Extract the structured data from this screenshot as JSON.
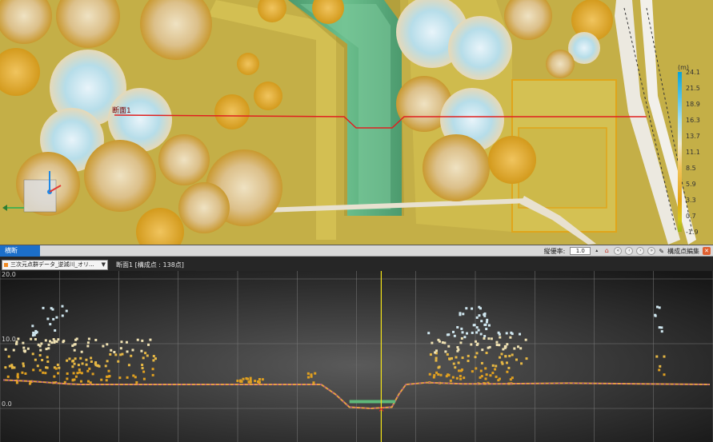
{
  "viewport": {
    "section_label": "断面1",
    "colorbar": {
      "unit": "(m)",
      "ticks": [
        "24.1",
        "21.5",
        "18.9",
        "16.3",
        "13.7",
        "11.1",
        "8.5",
        "5.9",
        "3.3",
        "0.7",
        "-1.9"
      ]
    },
    "colors": {
      "section_line": "#e02020",
      "water_channel": "#5cae7e",
      "ground": "#c9b34e"
    }
  },
  "panel": {
    "tab_label": "横断",
    "toolbar": {
      "vertical_ratio_label": "縦優率:",
      "vertical_ratio_value": "1.0",
      "edit_points_label": "構成点編集",
      "icons": [
        "spin-icon",
        "home-icon",
        "first-icon",
        "prev-icon",
        "next-icon",
        "last-icon",
        "edit-icon",
        "close-icon"
      ]
    },
    "dataset_select": "三次元点群データ_逆減川_オリ...",
    "section_title": "断面1 [構成点 : 138点]",
    "y_labels": [
      "20.0",
      "10.0",
      "0.0"
    ]
  },
  "chart_data": {
    "type": "scatter",
    "title": "断面1 [構成点 : 138点]",
    "ylim": [
      0,
      20
    ],
    "y_ticks": [
      20.0,
      10.0,
      0.0
    ],
    "series": [
      {
        "name": "三次元点群データ_逆減川_オリ...",
        "color": "#e8a040",
        "profile_x": [
          0.0,
          0.04,
          0.09,
          0.11,
          0.2,
          0.3,
          0.4,
          0.45,
          0.47,
          0.49,
          0.52,
          0.55,
          0.56,
          0.57,
          0.6,
          0.65,
          0.7,
          0.8,
          0.9,
          1.0
        ],
        "profile_y": [
          4.4,
          4.2,
          3.8,
          3.7,
          3.7,
          3.7,
          3.7,
          3.7,
          2.2,
          0.2,
          0.0,
          0.2,
          2.2,
          3.7,
          4.0,
          3.8,
          3.8,
          3.9,
          3.8,
          3.7
        ]
      }
    ],
    "marker_x": 0.535
  }
}
